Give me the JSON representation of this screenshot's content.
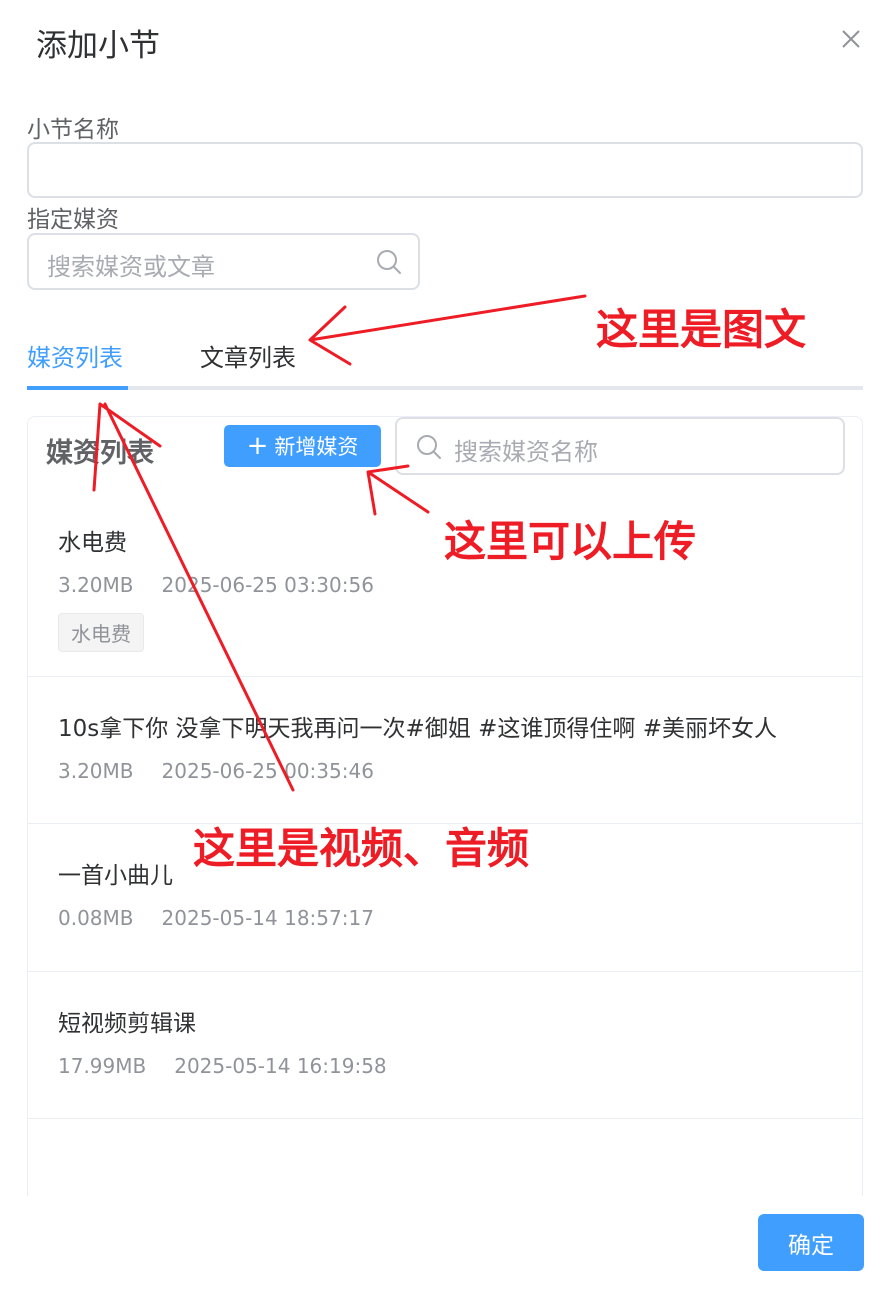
{
  "dialog": {
    "title": "添加小节",
    "confirm_label": "确定"
  },
  "form": {
    "name_label": "小节名称",
    "name_value": "",
    "media_label": "指定媒资",
    "media_search_placeholder": "搜索媒资或文章"
  },
  "tabs": [
    {
      "label": "媒资列表",
      "active": true
    },
    {
      "label": "文章列表",
      "active": false
    }
  ],
  "panel": {
    "title": "媒资列表",
    "add_button_label": "新增媒资",
    "search_placeholder": "搜索媒资名称"
  },
  "media_items": [
    {
      "name": "水电费",
      "size": "3.20MB",
      "time": "2025-06-25 03:30:56",
      "tag": "水电费"
    },
    {
      "name": "10s拿下你 没拿下明天我再问一次#御姐 #这谁顶得住啊 #美丽坏女人",
      "size": "3.20MB",
      "time": "2025-06-25 00:35:46"
    },
    {
      "name": "一首小曲儿",
      "size": "0.08MB",
      "time": "2025-05-14 18:57:17"
    },
    {
      "name": "短视频剪辑课",
      "size": "17.99MB",
      "time": "2025-05-14 16:19:58"
    }
  ],
  "annotations": {
    "article_note": "这里是图文",
    "upload_note": "这里可以上传",
    "media_note": "这里是视频、音频"
  },
  "colors": {
    "primary": "#409eff",
    "annotation": "#ee1c25"
  }
}
